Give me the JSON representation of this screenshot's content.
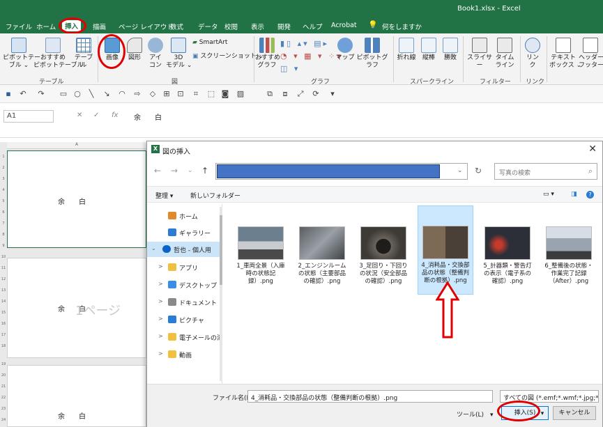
{
  "window": {
    "document_title": "Book1.xlsx  -  Excel",
    "tabs": [
      "ファイル",
      "ホーム",
      "挿入",
      "描画",
      "ページ レイアウト",
      "数式",
      "データ",
      "校閲",
      "表示",
      "開発",
      "ヘルプ",
      "Acrobat",
      "何をしますか"
    ],
    "active_tab": "挿入"
  },
  "ribbon": {
    "buttons": {
      "pivot": "ピボットテー\nブル ⌄",
      "recommended_pivot": "おすすめ\nピボットテーブル",
      "table": "テーブル",
      "image": "画像",
      "shapes": "図形",
      "icons": "アイ\nコン",
      "model3d": "3D\nモデル ⌄",
      "smartart": "SmartArt",
      "screenshot": "スクリーンショット ⌄",
      "rec_charts": "おすすめ\nグラフ",
      "maps": "マップ",
      "pivot_chart": "ピボットグラフ",
      "line": "折れ線",
      "column": "縦棒",
      "winloss": "勝敗",
      "slicer": "スライサー",
      "timeline": "タイム\nライン",
      "link": "リン\nク",
      "textbox": "テキスト\nボックス ⌄",
      "header_footer": "ヘッダーと\nフッター"
    },
    "groups": {
      "table": "テーブル",
      "illustrations": "図",
      "charts": "グラフ",
      "sparklines": "スパークライン",
      "filters": "フィルター",
      "links": "リンク"
    }
  },
  "formula_bar": {
    "name_box": "A1",
    "fx": "fx",
    "value": "余　　白"
  },
  "sheet": {
    "col_a": "A",
    "margin_text": "余　　白",
    "watermark": "1ページ",
    "rows_page1": [
      "1",
      "2",
      "3",
      "4",
      "5",
      "6",
      "7",
      "8",
      "9"
    ],
    "rows_page2": [
      "10",
      "11",
      "12",
      "13",
      "14",
      "15",
      "16",
      "17",
      "18"
    ],
    "rows_page3": [
      "19",
      "20",
      "21",
      "22",
      "23",
      "24",
      "25"
    ]
  },
  "dialog": {
    "title": "図の挿入",
    "search_placeholder": "写真の検索",
    "organize": "整理 ▾",
    "new_folder": "新しいフォルダー",
    "nav": [
      {
        "label": "ホーム",
        "icon": "home-icon",
        "color": "#e08a2c",
        "chevron": ""
      },
      {
        "label": "ギャラリー",
        "icon": "gallery-icon",
        "color": "#2b7cd3",
        "chevron": ""
      },
      {
        "label": "哲也 - 個人用",
        "icon": "onedrive-icon",
        "color": "#0a64c8",
        "chevron": "⌄"
      },
      {
        "label": "アプリ",
        "icon": "folder-icon",
        "color": "#f0c040",
        "chevron": ">"
      },
      {
        "label": "デスクトップ",
        "icon": "desktop-icon",
        "color": "#3a8ee6",
        "chevron": ">"
      },
      {
        "label": "ドキュメント",
        "icon": "document-icon",
        "color": "#8a8a8a",
        "chevron": ">"
      },
      {
        "label": "ピクチャ",
        "icon": "pictures-icon",
        "color": "#2b7cd3",
        "chevron": ">"
      },
      {
        "label": "電子メールの添付",
        "icon": "folder-icon",
        "color": "#f0c040",
        "chevron": ">"
      },
      {
        "label": "動画",
        "icon": "folder-icon",
        "color": "#f0c040",
        "chevron": ">"
      }
    ],
    "files": [
      {
        "name": "1_車両全景（入庫時の状態記録）.png",
        "thumb": "#6b7f8f"
      },
      {
        "name": "2_エンジンルームの状態（主要部品の確認）.png",
        "thumb": "#5a5e63"
      },
      {
        "name": "3_足回り・下回りの状況（安全部品の確認）.png",
        "thumb": "#3e3a36"
      },
      {
        "name": "4_消耗品・交換部品の状態（整備判断の根拠）.png",
        "thumb": "#7d6a55"
      },
      {
        "name": "5_計器類・警告灯の表示（電子系の確認）.png",
        "thumb": "#2c2f38"
      },
      {
        "name": "6_整備後の状態・作業完了記録（After）.png",
        "thumb": "#9aa4b0"
      }
    ],
    "filename_label": "ファイル名(N):",
    "filename_value": "4_消耗品・交換部品の状態（整備判断の根拠）.png",
    "filter": "すべての図 (*.emf;*.wmf;*.jpg;*.jp",
    "tools": "ツール(L)　▾",
    "insert": "挿入(S)",
    "cancel": "キャンセル"
  }
}
